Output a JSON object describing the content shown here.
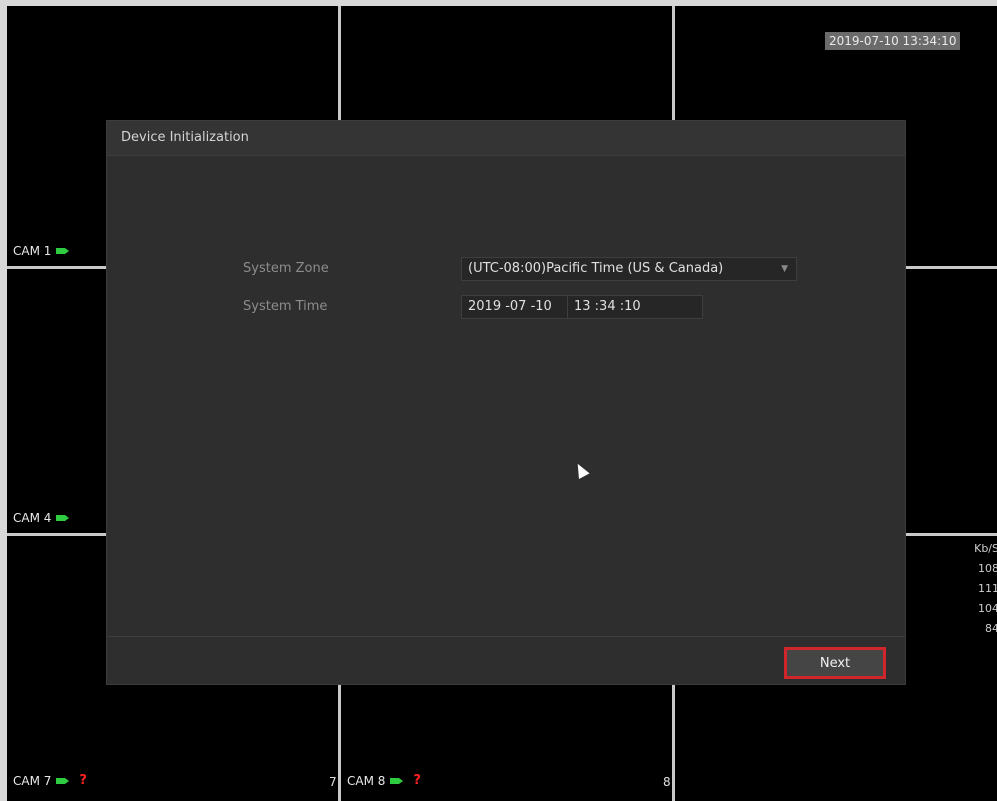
{
  "overlay": {
    "timestamp": "2019-07-10 13:34:10",
    "cameras": [
      {
        "label": "CAM 1"
      },
      {
        "label": "CAM 4"
      },
      {
        "label": "CAM 7",
        "status": "?",
        "channel": "7"
      },
      {
        "label": "CAM 8",
        "status": "?",
        "channel": "8"
      }
    ],
    "side_stats": {
      "unit": "Kb/S",
      "values": [
        "108",
        "111",
        "104",
        "84"
      ]
    }
  },
  "dialog": {
    "title": "Device Initialization",
    "fields": {
      "system_zone": {
        "label": "System Zone",
        "value": "(UTC-08:00)Pacific Time (US & Canada)"
      },
      "system_time": {
        "label": "System Time",
        "date": "2019 -07 -10",
        "time": "13 :34 :10"
      }
    },
    "next_label": "Next"
  },
  "colors": {
    "camera_icon": "#2ecc40",
    "alert": "#ff2020",
    "highlight_border": "#d0252a"
  }
}
